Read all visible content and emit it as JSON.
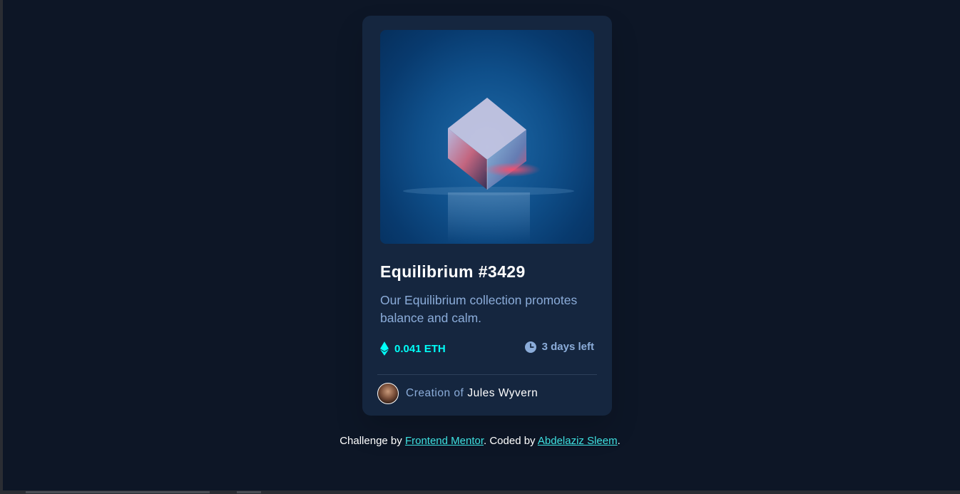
{
  "card": {
    "title": "Equilibrium #3429",
    "description": "Our Equilibrium collection promotes balance and calm.",
    "price": "0.041 ETH",
    "time_left": "3 days left",
    "creator_prefix": "Creation of",
    "creator_name": "Jules Wyvern",
    "image_alt": "Equilibrium"
  },
  "attribution": {
    "challenge_prefix": "Challenge by",
    "challenge_link": "Frontend Mentor",
    "coded_prefix": ". Coded by",
    "coder_link": "Abdelaziz Sleem",
    "suffix": "."
  },
  "icons": {
    "price": "ethereum-icon",
    "time": "clock-icon"
  },
  "colors": {
    "page_bg": "#0d1626",
    "card_bg": "#15263f",
    "accent_cyan": "#00fff8",
    "soft_blue": "#8bacd9",
    "white": "#ffffff"
  }
}
